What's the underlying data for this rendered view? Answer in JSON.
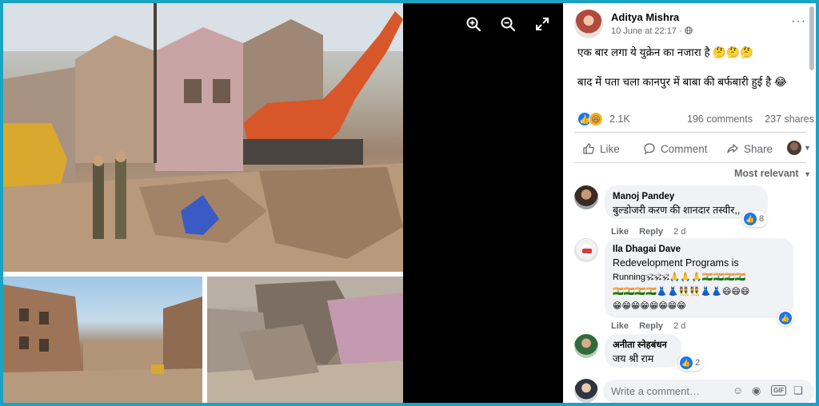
{
  "colors": {
    "accent": "#1877f2",
    "frame": "#1aa3c4",
    "muted": "#65676b",
    "bubble": "#f0f2f5"
  },
  "viewer": {
    "tools": [
      {
        "name": "zoom-in-icon"
      },
      {
        "name": "zoom-out-icon"
      },
      {
        "name": "expand-icon"
      }
    ]
  },
  "post": {
    "author": "Aditya Mishra",
    "timestamp": "10 June at 22:17",
    "audience_icon": "globe-icon",
    "more": "···",
    "line1": "एक बार लगा ये युक्रेन का नजारा है 🤔🤔🤔",
    "line2": "बाद में पता चला कानपुर में बाबा की बर्फबारी हुई है 😂",
    "reactions_count": "2.1K",
    "comments_count": "196 comments",
    "shares_count": "237 shares"
  },
  "actions": {
    "like": "Like",
    "comment": "Comment",
    "share": "Share"
  },
  "sort": {
    "label": "Most relevant"
  },
  "comments": [
    {
      "name": "Manoj Pandey",
      "text": "बुल्डोजरी करण की शानदार तस्वीर,,",
      "reactions": "8",
      "like": "Like",
      "reply": "Reply",
      "time": "2 d"
    },
    {
      "name": "Ila Dhagai Dave",
      "text_lines": [
        "Redevelopment Programs is",
        "Running🕉🕉🕉🙏🙏🙏🇮🇳🇮🇳🇮🇳🇮🇳",
        "🇮🇳🇮🇳🇮🇳🇮🇳👗👗👯👯👗👗😄😄😄",
        "😁😁😁😁😁😁😁😁"
      ],
      "reactions": "",
      "like": "Like",
      "reply": "Reply",
      "time": "2 d"
    },
    {
      "name": "अनीता स्नेहबंधन",
      "text": "जय श्री राम",
      "reactions": "2"
    }
  ],
  "composer": {
    "placeholder": "Write a comment…"
  }
}
